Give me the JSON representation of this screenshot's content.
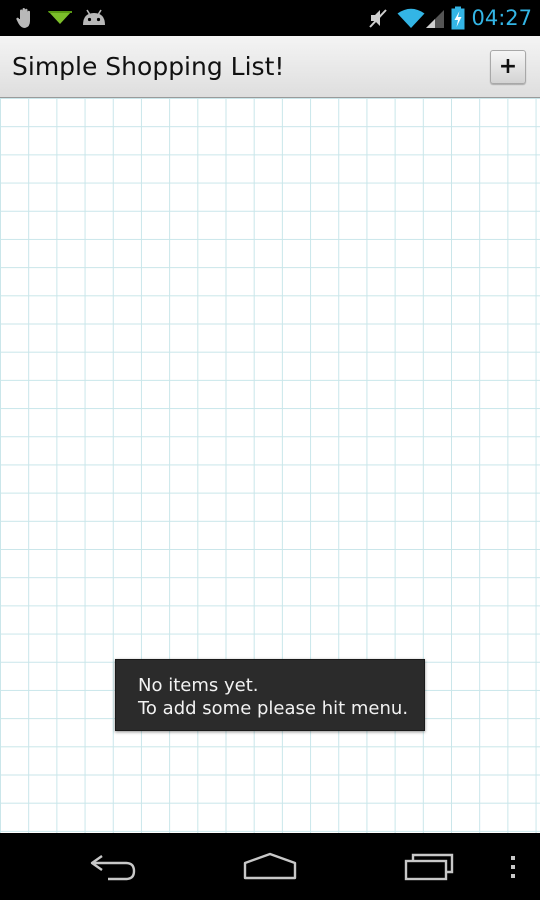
{
  "status_bar": {
    "notification_icons": [
      "hand-icon",
      "download-arrow-icon",
      "android-icon"
    ],
    "system_icons": [
      "mute-icon",
      "wifi-icon",
      "signal-icon",
      "battery-charging-icon"
    ],
    "time": "04:27",
    "time_color": "#33b5e5"
  },
  "action_bar": {
    "title": "Simple Shopping List!",
    "add_button_label": "+"
  },
  "toast": {
    "line1": "No items yet.",
    "line2": "To add some please hit menu."
  },
  "nav_bar": {
    "buttons": [
      "back-icon",
      "home-icon",
      "recent-apps-icon",
      "overflow-menu-icon"
    ]
  },
  "colors": {
    "grid_line": "#c9e6ea",
    "toast_bg": "#2b2b2b",
    "action_bar_bg": "#e8e8e8"
  }
}
